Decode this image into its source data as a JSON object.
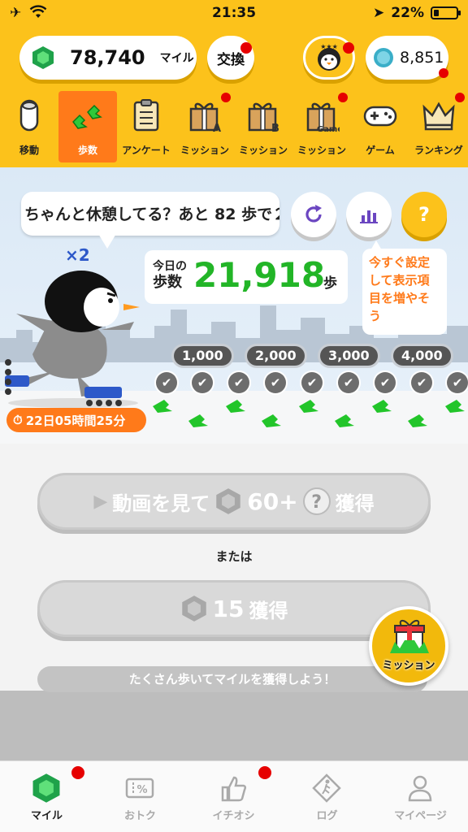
{
  "status_bar": {
    "time": "21:35",
    "battery": "22%"
  },
  "header": {
    "miles_value": "78,740",
    "miles_unit": "マイル",
    "exchange_label": "交換",
    "coins_value": "8,851"
  },
  "nav": {
    "items": [
      {
        "label": "移動",
        "icon": "tube-icon"
      },
      {
        "label": "歩数",
        "icon": "footprints-icon"
      },
      {
        "label": "アンケート",
        "icon": "clipboard-icon"
      },
      {
        "label": "ミッション",
        "icon": "gift-a-icon",
        "badge": "A"
      },
      {
        "label": "ミッション",
        "icon": "gift-b-icon",
        "badge": "B"
      },
      {
        "label": "ミッション",
        "icon": "gift-game-icon",
        "badge": "Game"
      },
      {
        "label": "ゲーム",
        "icon": "gamepad-icon"
      },
      {
        "label": "ランキング",
        "icon": "crown-icon"
      }
    ],
    "active_index": 1
  },
  "scene": {
    "speech_text": "ちゃんと休憩してる？あと 82 歩で２",
    "multiplier": "×2",
    "steps_label_line1": "今日の",
    "steps_label_line2": "歩数",
    "steps_value": "21,918",
    "steps_unit": "歩",
    "hint_text": "今すぐ設定して表示項目を増やそう",
    "milestones": [
      "1,000",
      "2,000",
      "3,000",
      "4,000"
    ],
    "timer_text": "22日05時間25分"
  },
  "rewards": {
    "video_prefix": "動画を見て",
    "video_amount": "60+",
    "video_suffix": "獲得",
    "or_text": "または",
    "earn_amount": "15",
    "earn_suffix": "獲得",
    "banner_text": "たくさん歩いてマイルを獲得しよう！",
    "mission_label": "ミッション"
  },
  "tabbar": {
    "items": [
      {
        "label": "マイル",
        "icon": "gem-icon"
      },
      {
        "label": "おトク",
        "icon": "coupon-icon"
      },
      {
        "label": "イチオシ",
        "icon": "thumbs-up-icon"
      },
      {
        "label": "ログ",
        "icon": "walker-icon"
      },
      {
        "label": "マイページ",
        "icon": "person-icon"
      }
    ],
    "active_index": 0
  },
  "colors": {
    "brand_yellow": "#fcc21b",
    "accent_orange": "#ff7a1a",
    "steps_green": "#22b527",
    "badge_red": "#e60000"
  }
}
